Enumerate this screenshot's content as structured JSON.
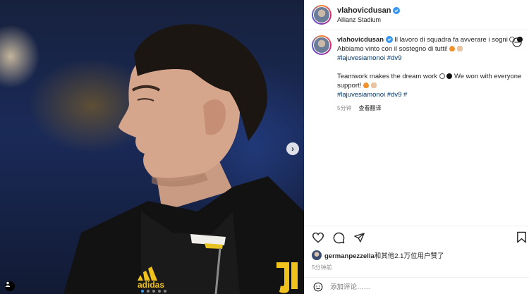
{
  "post": {
    "username": "vlahovicdusan",
    "location": "Allianz Stadium",
    "caption": {
      "username": "vlahovicdusan",
      "line1": "Il lavoro di squadra fa avverare i sogni",
      "line2": "Abbiamo vinto con il sostegno di tutti!",
      "tags1": "#lajuvesiamonoi #dv9",
      "line3": "Teamwork makes the dream work",
      "line4a": "We won with everyone",
      "line4b": "support!",
      "tags2a": "#lajuvesiamonoi #dv9",
      "tags2b": "#"
    },
    "caption_time": "5分钟",
    "see_translation": "查看翻译",
    "likes": {
      "user": "germanpezzella",
      "text": "和其他2.1万位用户赞了"
    },
    "post_time": "5分钟前",
    "comment_placeholder": "添加评论……"
  },
  "icons": {
    "verified": "verified-badge-icon",
    "more": "more-options-icon",
    "like": "heart-icon",
    "comment": "comment-icon",
    "share": "share-icon",
    "save": "bookmark-icon",
    "emoji": "emoji-icon",
    "next": "chevron-right-icon",
    "tag": "user-tag-icon"
  },
  "photo": {
    "jersey_brand": "adidas",
    "carousel_slides": 5,
    "active_slide": 1
  },
  "colors": {
    "verified_blue": "#3897f0",
    "hashtag_blue": "#00376b",
    "muted_text": "#8e8e8e",
    "jersey_yellow": "#f2c21c"
  }
}
